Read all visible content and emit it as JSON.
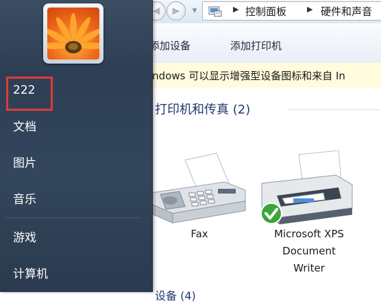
{
  "addressbar": {
    "crumbs": [
      "控制面板",
      "硬件和声音"
    ],
    "back_glyph": "◀",
    "forward_glyph": "▶",
    "dropdown_glyph": "▼",
    "separator_glyph": "▶"
  },
  "commandbar": {
    "add_device": "添加设备",
    "add_printer": "添加打印机"
  },
  "infobar": {
    "text": "indows 可以显示增强型设备图标和来自 In"
  },
  "content": {
    "group_header": "打印机和传真 (2)",
    "devices": [
      {
        "label": "Fax",
        "icon": "fax-machine-icon"
      },
      {
        "label": "Microsoft XPS Document Writer",
        "icon": "printer-icon",
        "default": true
      }
    ],
    "next_group_partial": "设备 (4)"
  },
  "startmenu": {
    "user_picture": "flower-user-picture",
    "items": [
      {
        "label": "222"
      },
      {
        "label": "文档"
      },
      {
        "label": "图片"
      },
      {
        "label": "音乐"
      },
      {
        "label": "游戏"
      },
      {
        "label": "计算机"
      }
    ],
    "highlight_color": "#e23a36"
  }
}
